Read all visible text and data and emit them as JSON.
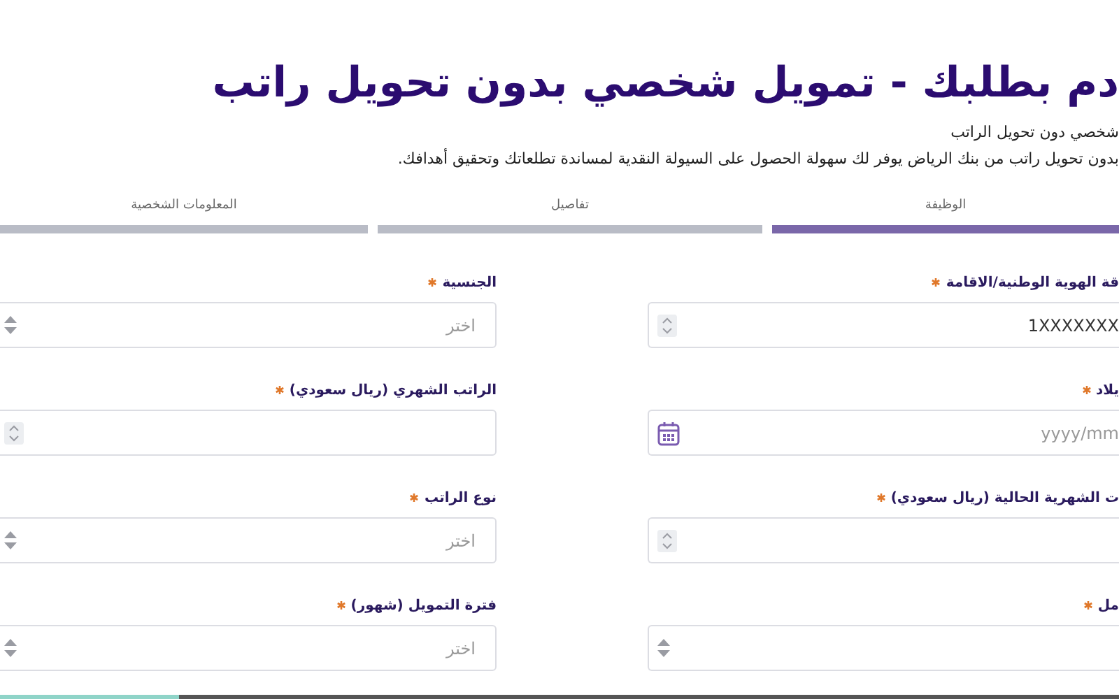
{
  "title": "دم بطلبك - تمويل شخصي بدون تحويل راتب",
  "intro": {
    "heading": "شخصي دون تحويل الراتب",
    "text": "بدون تحويل راتب من بنك الرياض يوفر لك سهولة الحصول على السيولة النقدية لمساندة تطلعاتك وتحقيق أهدافك."
  },
  "steps": [
    {
      "label": "الوظيفة",
      "selected": true
    },
    {
      "label": "تفاصيل",
      "selected": false
    },
    {
      "label": "المعلومات الشخصية",
      "selected": false
    }
  ],
  "fields": [
    {
      "kind": "number",
      "label": "قة الهوية الوطنية/الاقامة",
      "required": true,
      "value": "1XXXXXXX"
    },
    {
      "kind": "select",
      "label": "الجنسية",
      "required": true,
      "placeholder": "اختر"
    },
    {
      "kind": "date",
      "label": "يلاد",
      "required": true,
      "placeholder": "yyyy/mm"
    },
    {
      "kind": "number",
      "label": "الراتب الشهري (ريال سعودي)",
      "required": true
    },
    {
      "kind": "number",
      "label": "ت الشهرية الحالية (ريال سعودي)",
      "required": true
    },
    {
      "kind": "select",
      "label": "نوع الراتب",
      "required": true,
      "placeholder": "اختر"
    },
    {
      "kind": "select",
      "label": "مل",
      "required": true
    },
    {
      "kind": "select",
      "label": "فترة التمويل (شهور)",
      "required": true,
      "placeholder": "اختر"
    }
  ]
}
